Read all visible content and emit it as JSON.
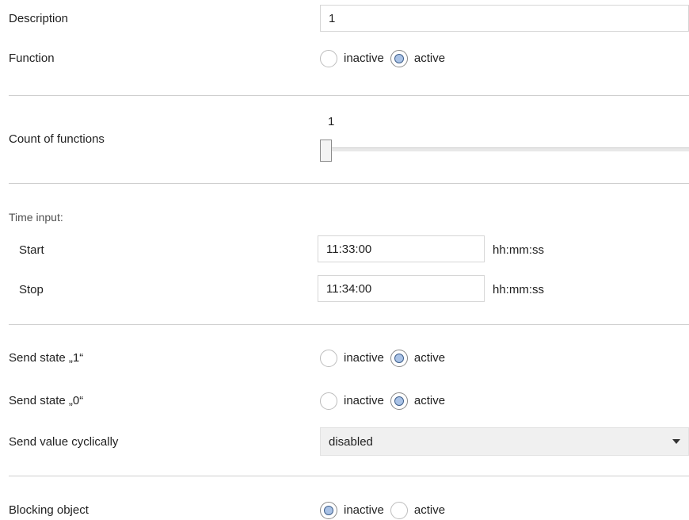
{
  "description": {
    "label": "Description",
    "value": "1"
  },
  "function": {
    "label": "Function",
    "options": [
      "inactive",
      "active"
    ],
    "selected": "active"
  },
  "count": {
    "label": "Count of functions",
    "value": "1",
    "slider_fraction": 0.0
  },
  "time_input": {
    "title": "Time input:",
    "start": {
      "label": "Start",
      "value": "11:33:00",
      "unit": "hh:mm:ss"
    },
    "stop": {
      "label": "Stop",
      "value": "11:34:00",
      "unit": "hh:mm:ss"
    }
  },
  "send_state_1": {
    "label": "Send state „1“",
    "options": [
      "inactive",
      "active"
    ],
    "selected": "active"
  },
  "send_state_0": {
    "label": "Send state „0“",
    "options": [
      "inactive",
      "active"
    ],
    "selected": "active"
  },
  "send_cyclic": {
    "label": "Send value cyclically",
    "value": "disabled"
  },
  "blocking": {
    "label": "Blocking object",
    "options": [
      "inactive",
      "active"
    ],
    "selected": "inactive"
  },
  "icons": {
    "dropdown_caret": "chevron-down-icon"
  }
}
